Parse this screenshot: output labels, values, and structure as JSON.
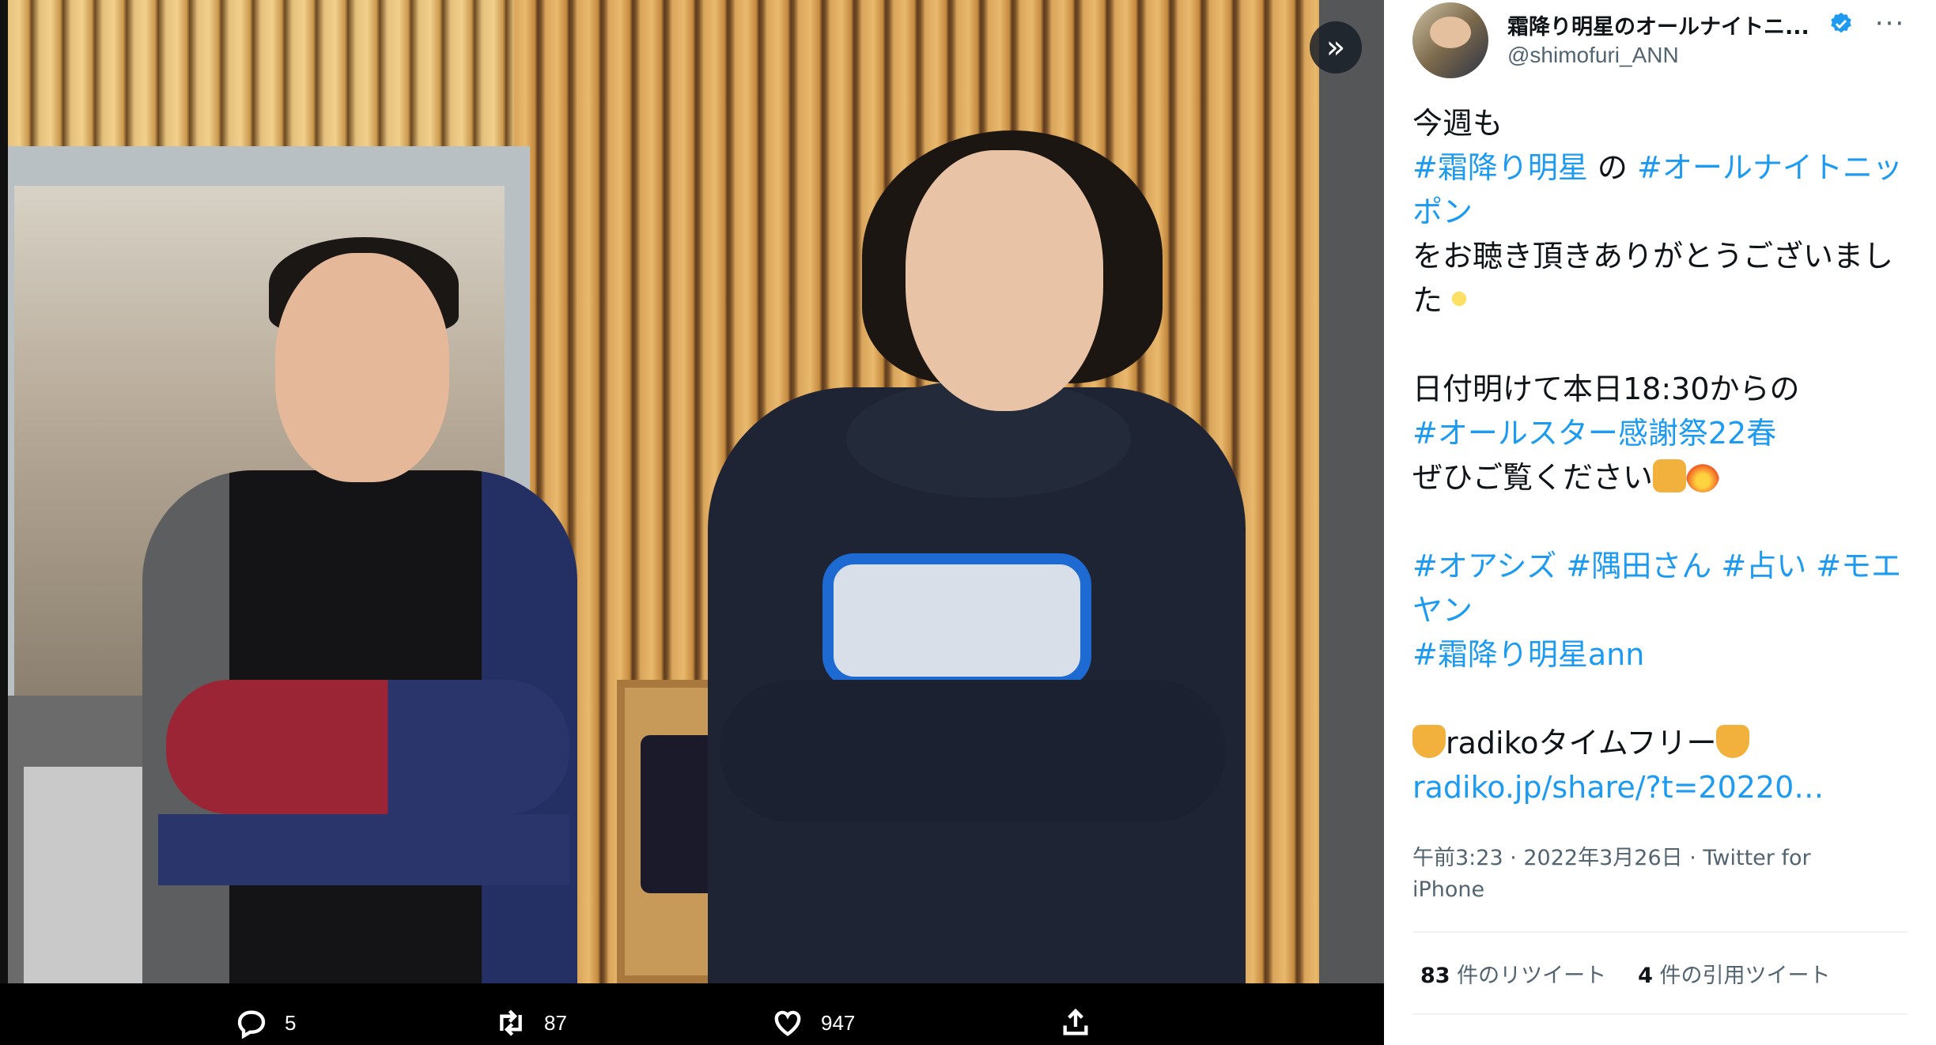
{
  "media": {
    "next_icon": "»",
    "actions": {
      "reply_count": "5",
      "retweet_count": "87",
      "like_count": "947"
    }
  },
  "tweet": {
    "display_name": "霜降り明星のオールナイトニ...",
    "handle": "@shimofuri_ANN",
    "more_icon": "···",
    "text": {
      "line1": "今週も",
      "tag1": "#霜降り明星",
      "line2_mid": " の ",
      "tag2": "#オールナイトニッポン",
      "line3": "をお聴き頂きありがとうございました",
      "line4": "日付明けて本日18:30からの",
      "tag3": "#オールスター感謝祭22春",
      "line5": "ぜひご覧ください",
      "tags_row": [
        "#オアシズ",
        "#隅田さん",
        "#占い",
        "#モエヤン"
      ],
      "tag4": "#霜降り明星ann",
      "line6": "radikoタイムフリー",
      "link": "radiko.jp/share/?t=20220…"
    },
    "timestamp": "午前3:23 · 2022年3月26日 · Twitter for iPhone",
    "stats": {
      "retweets_num": "83",
      "retweets_label": " 件のリツイート",
      "quotes_num": "4",
      "quotes_label": " 件の引用ツイート"
    }
  },
  "colors": {
    "link": "#1d9bf0",
    "text": "#0f1419",
    "secondary": "#536471",
    "verified": "#1d9bf0"
  },
  "icons": [
    "reply-icon",
    "retweet-icon",
    "like-icon",
    "share-icon",
    "verified-badge-icon",
    "next-arrow-icon",
    "more-icon"
  ]
}
